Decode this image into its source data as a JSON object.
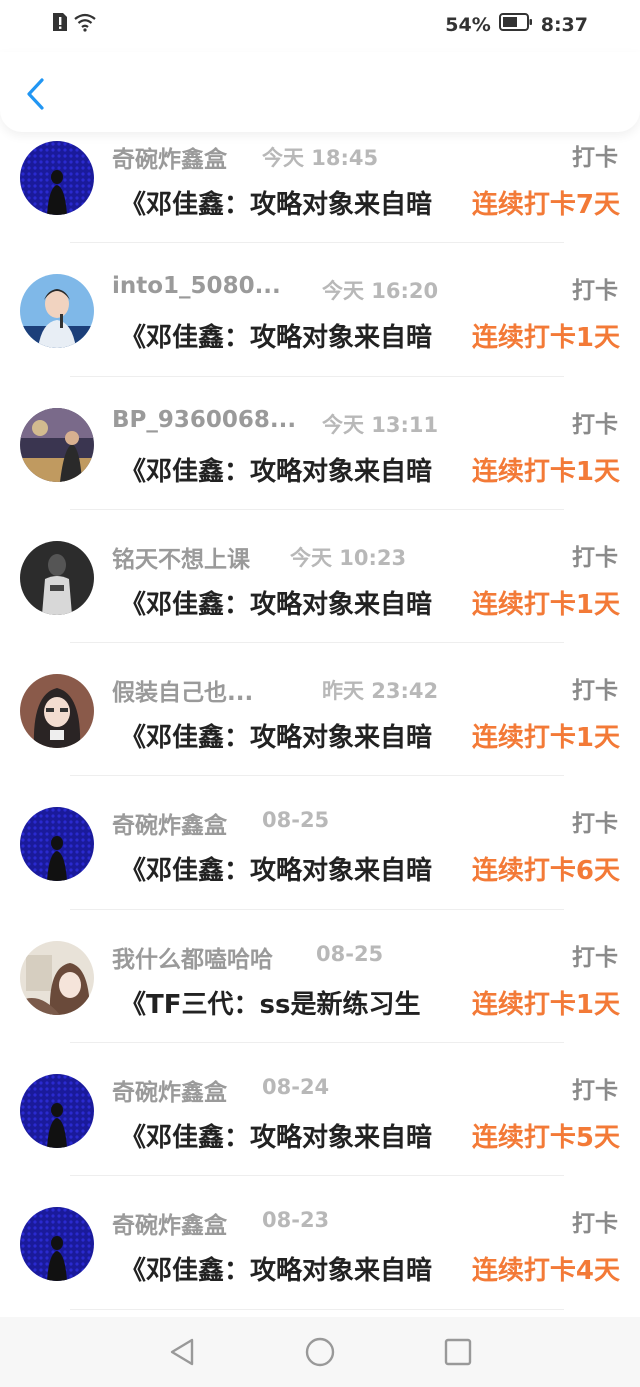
{
  "status_bar": {
    "battery": "54%",
    "time": "8:37",
    "icons": [
      "sim-alert-icon",
      "wifi-icon",
      "battery-icon"
    ]
  },
  "header": {
    "back_icon": "chevron-left-icon"
  },
  "colors": {
    "accent": "#f37a37",
    "back": "#2196f3"
  },
  "checkins": [
    {
      "name": "奇碗炸鑫盒",
      "time": "今天 18:45",
      "action": "打卡",
      "title": "《邓佳鑫：攻略对象来自暗",
      "streak": "连续打卡7天",
      "avatar": "blue-dots"
    },
    {
      "name": "into1_5080...",
      "time": "今天 16:20",
      "action": "打卡",
      "title": "《邓佳鑫：攻略对象来自暗",
      "streak": "连续打卡1天",
      "avatar": "stage-blue"
    },
    {
      "name": "BP_9360068...",
      "time": "今天 13:11",
      "action": "打卡",
      "title": "《邓佳鑫：攻略对象来自暗",
      "streak": "连续打卡1天",
      "avatar": "stage-warm"
    },
    {
      "name": "铭天不想上课",
      "time": "今天 10:23",
      "action": "打卡",
      "title": "《邓佳鑫：攻略对象来自暗",
      "streak": "连续打卡1天",
      "avatar": "dark-gray"
    },
    {
      "name": "假装自己也...",
      "time": "昨天 23:42",
      "action": "打卡",
      "title": "《邓佳鑫：攻略对象来自暗",
      "streak": "连续打卡1天",
      "avatar": "selfie"
    },
    {
      "name": "奇碗炸鑫盒",
      "time": "08-25",
      "action": "打卡",
      "title": "《邓佳鑫：攻略对象来自暗",
      "streak": "连续打卡6天",
      "avatar": "blue-dots"
    },
    {
      "name": "我什么都嗑哈哈",
      "time": "08-25",
      "action": "打卡",
      "title": "《TF三代：ss是新练习生",
      "streak": "连续打卡1天",
      "avatar": "light-portrait"
    },
    {
      "name": "奇碗炸鑫盒",
      "time": "08-24",
      "action": "打卡",
      "title": "《邓佳鑫：攻略对象来自暗",
      "streak": "连续打卡5天",
      "avatar": "blue-dots"
    },
    {
      "name": "奇碗炸鑫盒",
      "time": "08-23",
      "action": "打卡",
      "title": "《邓佳鑫：攻略对象来自暗",
      "streak": "连续打卡4天",
      "avatar": "blue-dots"
    }
  ],
  "nav_bar": {
    "icons": [
      "back-triangle-icon",
      "home-circle-icon",
      "recents-square-icon"
    ]
  }
}
